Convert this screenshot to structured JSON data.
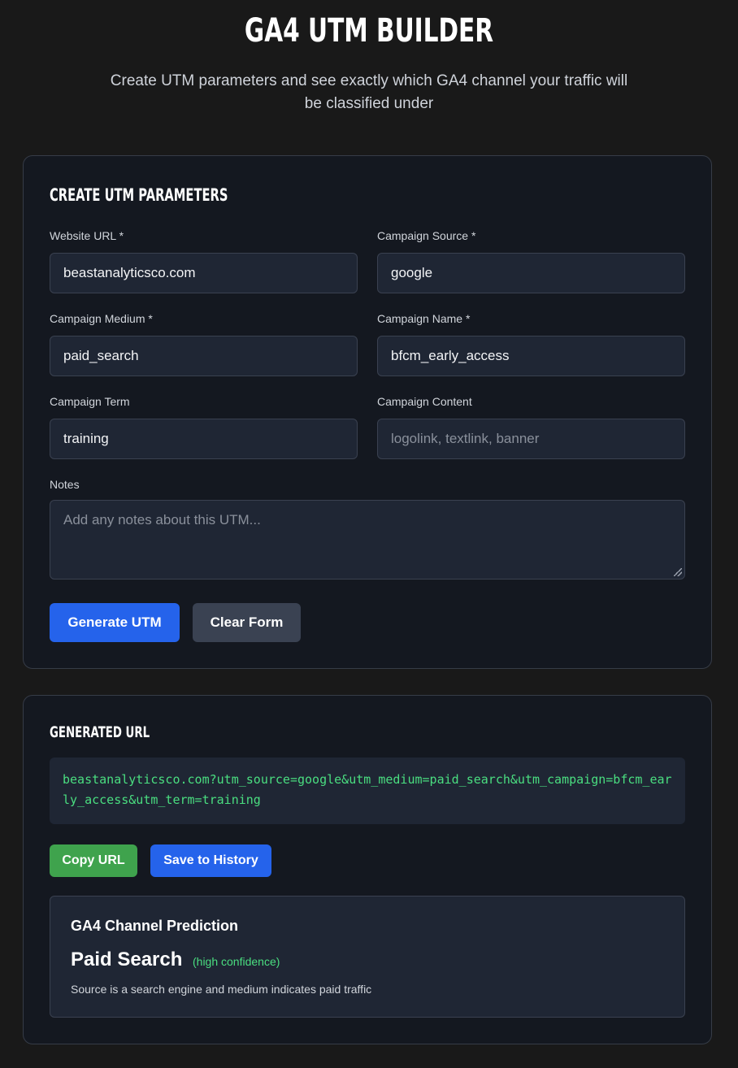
{
  "header": {
    "title": "GA4 UTM BUILDER",
    "subtitle": "Create UTM parameters and see exactly which GA4 channel your traffic will be classified under"
  },
  "form": {
    "section_title": "Create UTM Parameters",
    "fields": [
      {
        "label": "Website URL *",
        "value": "beastanalyticsco.com",
        "placeholder": ""
      },
      {
        "label": "Campaign Source *",
        "value": "google",
        "placeholder": ""
      },
      {
        "label": "Campaign Medium *",
        "value": "paid_search",
        "placeholder": ""
      },
      {
        "label": "Campaign Name *",
        "value": "bfcm_early_access",
        "placeholder": ""
      },
      {
        "label": "Campaign Term",
        "value": "training",
        "placeholder": ""
      },
      {
        "label": "Campaign Content",
        "value": "",
        "placeholder": "logolink, textlink, banner"
      }
    ],
    "notes": {
      "label": "Notes",
      "value": "",
      "placeholder": "Add any notes about this UTM..."
    },
    "generate_label": "Generate UTM",
    "clear_label": "Clear Form"
  },
  "result": {
    "section_title": "Generated URL",
    "url": "beastanalyticsco.com?utm_source=google&utm_medium=paid_search&utm_campaign=bfcm_early_access&utm_term=training",
    "copy_label": "Copy URL",
    "save_label": "Save to History",
    "prediction": {
      "heading": "GA4 Channel Prediction",
      "channel": "Paid Search",
      "confidence": "(high confidence)",
      "reason": "Source is a search engine and medium indicates paid traffic"
    }
  },
  "colors": {
    "background": "#191919",
    "card": "#141820",
    "primary": "#2563eb",
    "success": "#3fa34d",
    "url_text": "#4ade80"
  }
}
